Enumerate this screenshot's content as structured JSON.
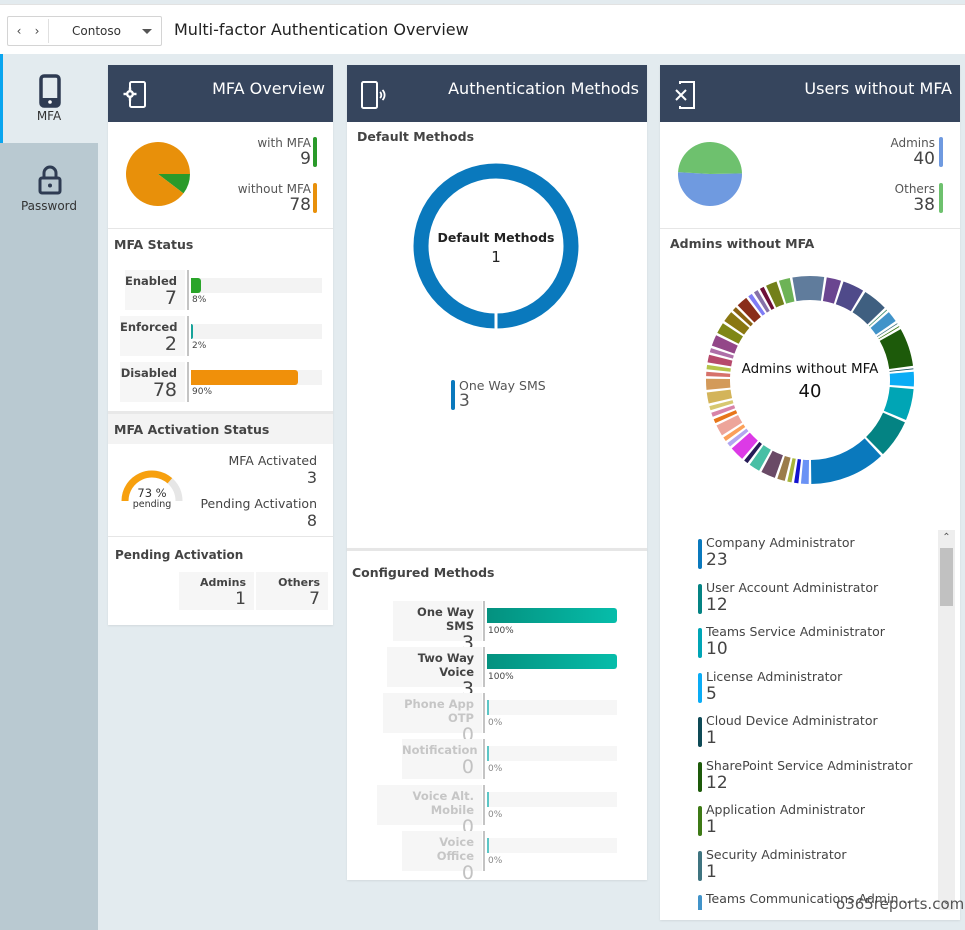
{
  "topbar": {
    "back_icon": "chevron-left-icon",
    "forward_icon": "chevron-right-icon",
    "tenant": "Contoso",
    "dropdown_icon": "caret-down-icon",
    "title": "Multi-factor Authentication Overview"
  },
  "sidebar": {
    "items": [
      {
        "label": "MFA",
        "icon": "mobile-phone-icon",
        "active": true
      },
      {
        "label": "Password",
        "icon": "lock-icon",
        "active": false
      }
    ]
  },
  "colors": {
    "header_bg": "#36455d",
    "accent": "#0aa5ef",
    "with_mfa": "#2a9a2a",
    "without_mfa": "#e8900a",
    "enforced": "#17a39a",
    "configured_bar": "#04a697",
    "default_method": "#0a79bd",
    "admins": "#6f9ae0",
    "others": "#6ec16e"
  },
  "mfa_overview": {
    "title": "MFA Overview",
    "icon": "phone-settings-icon",
    "legend": [
      {
        "label": "with MFA",
        "value": "9",
        "color": "#2a9a2a"
      },
      {
        "label": "without MFA",
        "value": "78",
        "color": "#e8900a"
      }
    ],
    "status": {
      "title": "MFA Status",
      "rows": [
        {
          "label": "Enabled",
          "value": "7",
          "percent": 8,
          "percent_label": "8%",
          "color": "#2aa52a"
        },
        {
          "label": "Enforced",
          "value": "2",
          "percent": 2,
          "percent_label": "2%",
          "color": "#17a39a"
        },
        {
          "label": "Disabled",
          "value": "78",
          "percent": 90,
          "percent_label": "90%",
          "color": "#f0900a"
        }
      ]
    },
    "activation": {
      "title": "MFA Activation Status",
      "gauge_percent": 73,
      "gauge_label": "73 %",
      "gauge_sub": "pending",
      "activated_label": "MFA Activated",
      "activated_value": "3",
      "pending_label": "Pending Activation",
      "pending_value": "8"
    },
    "pending": {
      "title": "Pending Activation",
      "admins_label": "Admins",
      "admins_value": "1",
      "others_label": "Others",
      "others_value": "7"
    }
  },
  "auth_methods": {
    "title": "Authentication Methods",
    "icon": "phone-signal-icon",
    "default": {
      "title": "Default Methods",
      "center_label": "Default Methods",
      "center_value": "1",
      "legend": [
        {
          "label": "One Way SMS",
          "value": "3",
          "color": "#0a79bd"
        }
      ]
    },
    "configured": {
      "title": "Configured Methods",
      "rows": [
        {
          "label": "One Way SMS",
          "value": "3",
          "percent": 100,
          "percent_label": "100%",
          "muted": false
        },
        {
          "label": "Two Way Voice",
          "value": "3",
          "percent": 100,
          "percent_label": "100%",
          "muted": false
        },
        {
          "label": "Phone App OTP",
          "value": "0",
          "percent": 0,
          "percent_label": "0%",
          "muted": true
        },
        {
          "label": "Notification",
          "value": "0",
          "percent": 0,
          "percent_label": "0%",
          "muted": true
        },
        {
          "label": "Voice Alt. Mobile",
          "value": "0",
          "percent": 0,
          "percent_label": "0%",
          "muted": true
        },
        {
          "label": "Voice Office",
          "value": "0",
          "percent": 0,
          "percent_label": "0%",
          "muted": true
        }
      ]
    }
  },
  "users_without_mfa": {
    "title": "Users without MFA",
    "icon": "phone-x-icon",
    "legend": [
      {
        "label": "Admins",
        "value": "40",
        "color": "#6f9ae0"
      },
      {
        "label": "Others",
        "value": "38",
        "color": "#6ec16e"
      }
    ],
    "admins_section": {
      "title": "Admins without MFA",
      "center_label": "Admins without MFA",
      "center_value": "40",
      "roles": [
        {
          "label": "Company Administrator",
          "value": "23",
          "color": "#0a79bd"
        },
        {
          "label": "User Account Administrator",
          "value": "12",
          "color": "#048383"
        },
        {
          "label": "Teams Service Administrator",
          "value": "10",
          "color": "#00a5b5"
        },
        {
          "label": "License Administrator",
          "value": "5",
          "color": "#0aacf5"
        },
        {
          "label": "Cloud Device Administrator",
          "value": "1",
          "color": "#0e4a56"
        },
        {
          "label": "SharePoint Service Administrator",
          "value": "12",
          "color": "#1d5a0a"
        },
        {
          "label": "Application Administrator",
          "value": "1",
          "color": "#3e7a16"
        },
        {
          "label": "Security Administrator",
          "value": "1",
          "color": "#3f7480"
        },
        {
          "label": "Teams Communications Admin...",
          "value": "",
          "color": "#4193c9"
        }
      ]
    },
    "scroll_up_icon": "chevron-up-icon",
    "scroll_down_icon": "chevron-down-icon"
  },
  "admin_donut_chart": {
    "type": "pie",
    "segments": [
      {
        "value": 23,
        "color": "#0a79bd"
      },
      {
        "value": 12,
        "color": "#048383"
      },
      {
        "value": 10,
        "color": "#00a5b5"
      },
      {
        "value": 5,
        "color": "#0aacf5"
      },
      {
        "value": 1,
        "color": "#0e4a56"
      },
      {
        "value": 12,
        "color": "#1d5a0a"
      },
      {
        "value": 1,
        "color": "#3e7a16"
      },
      {
        "value": 1,
        "color": "#3f7480"
      },
      {
        "value": 4,
        "color": "#4193c9"
      },
      {
        "value": 1,
        "color": "#3e8a6a"
      },
      {
        "value": 8,
        "color": "#3f5f80"
      },
      {
        "value": 7,
        "color": "#4f4a8a"
      },
      {
        "value": 5,
        "color": "#6a4590"
      },
      {
        "value": 10,
        "color": "#607c9c"
      },
      {
        "value": 4,
        "color": "#6db356"
      },
      {
        "value": 4,
        "color": "#72801a"
      },
      {
        "value": 2,
        "color": "#6e1038"
      },
      {
        "value": 2,
        "color": "#8671a8"
      },
      {
        "value": 2,
        "color": "#7f7cf5"
      },
      {
        "value": 4,
        "color": "#8a2d1a"
      },
      {
        "value": 2,
        "color": "#8a6112"
      },
      {
        "value": 4,
        "color": "#8a7712"
      },
      {
        "value": 4,
        "color": "#7f8716"
      },
      {
        "value": 4,
        "color": "#934788"
      },
      {
        "value": 2,
        "color": "#ae6fa8"
      },
      {
        "value": 3,
        "color": "#b64a6c"
      },
      {
        "value": 2,
        "color": "#b6c44a"
      },
      {
        "value": 2,
        "color": "#d6716a"
      },
      {
        "value": 4,
        "color": "#d39a5a"
      },
      {
        "value": 4,
        "color": "#d3b45a"
      },
      {
        "value": 2,
        "color": "#d7c870"
      },
      {
        "value": 2,
        "color": "#d883a8"
      },
      {
        "value": 2,
        "color": "#e7761a"
      },
      {
        "value": 4,
        "color": "#eda59a"
      },
      {
        "value": 2,
        "color": "#fba05a"
      },
      {
        "value": 2,
        "color": "#b3a6f0"
      },
      {
        "value": 5,
        "color": "#dc3ae6"
      },
      {
        "value": 2,
        "color": "#261b57"
      },
      {
        "value": 4,
        "color": "#48bfa5"
      },
      {
        "value": 5,
        "color": "#6a4a66"
      },
      {
        "value": 3,
        "color": "#9b7c4a"
      },
      {
        "value": 2,
        "color": "#a7b53a"
      },
      {
        "value": 2,
        "color": "#1313d0"
      },
      {
        "value": 3,
        "color": "#6a92f5"
      }
    ]
  },
  "watermark": "o365reports.com"
}
